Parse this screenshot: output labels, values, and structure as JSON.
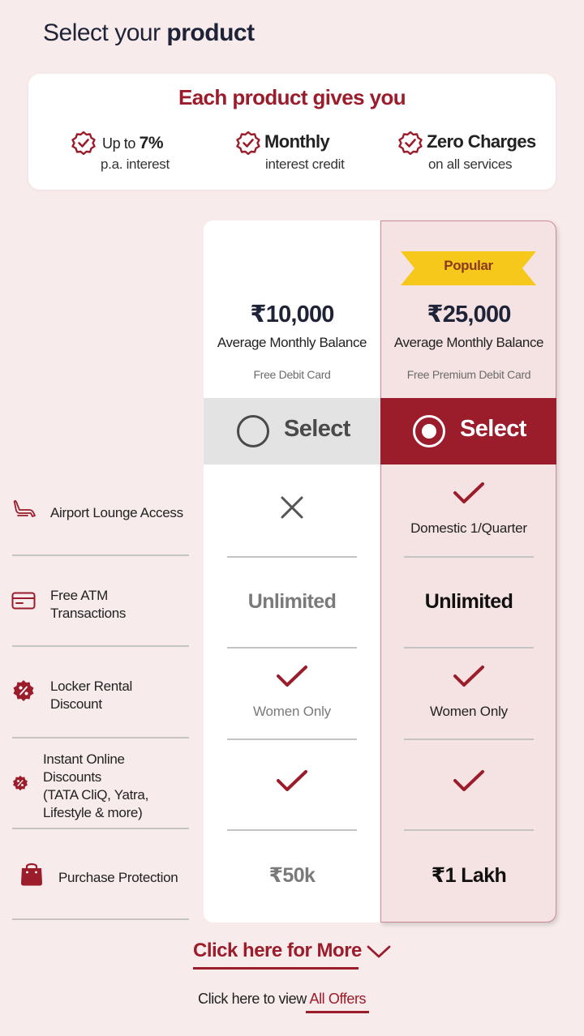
{
  "header": {
    "title_prefix": "Select your ",
    "title_bold": "product"
  },
  "benefits": {
    "title": "Each product gives you",
    "items": [
      {
        "icon": "badge-check-icon",
        "line1_prefix": "Up to ",
        "line1_strong": "7%",
        "line2": "p.a. interest"
      },
      {
        "icon": "badge-check-icon",
        "line1": "Monthly",
        "line2": "interest credit"
      },
      {
        "icon": "badge-check-icon",
        "line1": "Zero Charges",
        "line2": "on all services"
      }
    ]
  },
  "plans": [
    {
      "price": "₹10,000",
      "balance_label": "Average Monthly Balance",
      "card": "Free Debit Card",
      "select_label": "Select",
      "selected": false
    },
    {
      "badge": "Popular",
      "price": "₹25,000",
      "balance_label": "Average Monthly Balance",
      "card": "Free Premium Debit Card",
      "select_label": "Select",
      "selected": true
    }
  ],
  "features": [
    {
      "icon": "lounge-chair-icon",
      "label": "Airport Lounge Access",
      "basic": {
        "type": "cross"
      },
      "popular": {
        "type": "check",
        "note": "Domestic 1/Quarter"
      }
    },
    {
      "icon": "card-icon",
      "label_lines": [
        "Free ATM",
        "Transactions"
      ],
      "basic": {
        "type": "text",
        "value": "Unlimited"
      },
      "popular": {
        "type": "text",
        "value": "Unlimited"
      }
    },
    {
      "icon": "discount-badge-icon",
      "label_lines": [
        "Locker Rental",
        "Discount"
      ],
      "basic": {
        "type": "check",
        "note": "Women Only"
      },
      "popular": {
        "type": "check",
        "note": "Women Only"
      }
    },
    {
      "icon": "discount-badge-icon",
      "label_lines": [
        "Instant Online",
        "Discounts",
        "(TATA CliQ, Yatra,",
        "Lifestyle & more)"
      ],
      "basic": {
        "type": "check"
      },
      "popular": {
        "type": "check"
      }
    },
    {
      "icon": "shopping-bag-icon",
      "label": "Purchase Protection",
      "basic": {
        "type": "text",
        "value": "₹50k"
      },
      "popular": {
        "type": "text",
        "value": "₹1 Lakh"
      }
    }
  ],
  "footer": {
    "more_label": "Click here for More",
    "offers_prefix": "Click here to view ",
    "offers_link": "All Offers"
  },
  "colors": {
    "accent": "#9b1c2b",
    "background": "#f7ebeb",
    "popular_bg": "#f5e3e3",
    "ribbon": "#f7c81c"
  }
}
